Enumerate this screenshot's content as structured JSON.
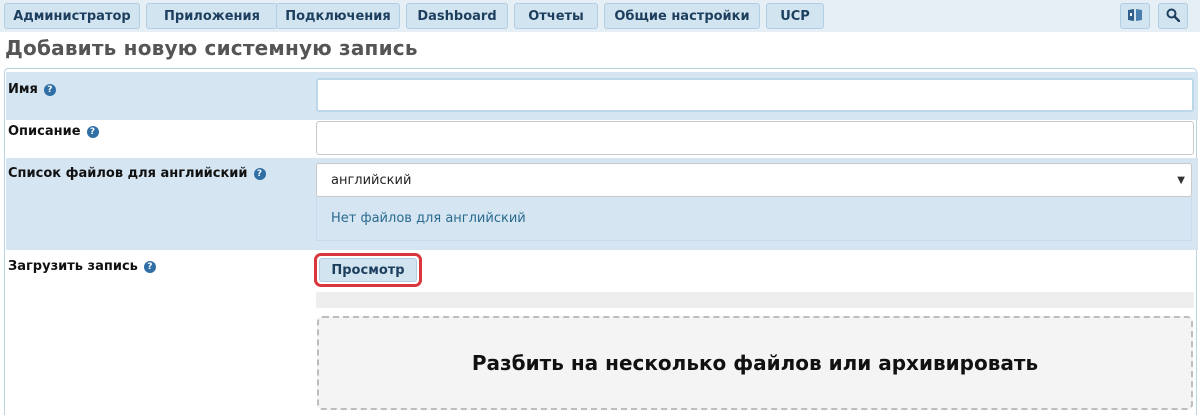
{
  "nav": {
    "tabs": [
      "Администратор",
      "Приложения",
      "Подключения",
      "Dashboard",
      "Отчеты",
      "Общие настройки",
      "UCP"
    ],
    "icons": [
      "book-icon",
      "search-icon"
    ]
  },
  "page": {
    "title": "Добавить новую системную запись"
  },
  "form": {
    "help_glyph": "?",
    "name_label": "Имя",
    "name_value": "",
    "description_label": "Описание",
    "description_value": "",
    "filelist_label": "Список файлов для английский",
    "language_selected": "английский",
    "caret": "▼",
    "no_files_text": "Нет файлов для английский",
    "upload_label": "Загрузить запись",
    "browse_label": "Просмотр",
    "dropzone_text": "Разбить на несколько файлов или архивировать"
  },
  "colors": {
    "accent": "#2f6fa5",
    "highlight": "#d9363e",
    "row_shade": "#d5e6f2"
  }
}
